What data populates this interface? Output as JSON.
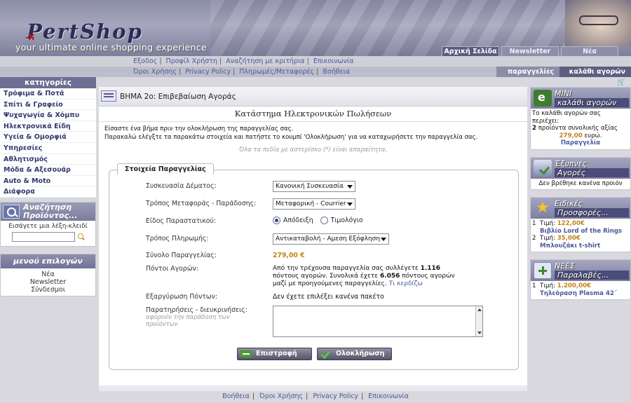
{
  "header": {
    "logo_text": "PertShop",
    "logo_mark": "x",
    "tagline": "your ultimate online shopping experience",
    "tabs": [
      "Αρχική Σελίδα",
      "Newsletter",
      "Νέα"
    ]
  },
  "topnav": {
    "row1": [
      "Εξοδος",
      "Προφίλ Χρήστη",
      "Αναζήτηση με κριτήρια",
      "Επικοινωνία"
    ],
    "row2": [
      "Όροι Χρήσης",
      "Privacy Policy",
      "Πληρωμές/Μεταφορές",
      "Βοήθεια"
    ],
    "orders_label": "παραγγελίες",
    "cart_label": "καλάθι αγορών"
  },
  "sidebar": {
    "categories_title": "κατηγορίες",
    "categories": [
      "Τρόφιμα & Ποτά",
      "Σπίτι & Γραφείο",
      "Ψυχαγωγία & Χόμπυ",
      "Ηλεκτρονικά Είδη",
      "Υγεία & Ομορφιά",
      "Υπηρεσίες",
      "Αθλητισμός",
      "Μόδα & Αξεσουάρ",
      "Auto & Moto",
      "Διάφορα"
    ],
    "search_title_line1": "Αναζήτηση",
    "search_title_line2": "Προϊόντος...",
    "search_hint": "Εισάγετε μια λέξη-κλειδί",
    "search_value": "",
    "menu_title": "μενού επιλογών",
    "menu_items": [
      "Νέα",
      "Newsletter",
      "Σύνδεσμοι"
    ]
  },
  "main": {
    "step_title": "ΒΗΜΑ 2ο: Επιβεβαίωση Αγοράς",
    "store_title": "Κατάστημα Ηλεκτρονικών Πωλήσεων",
    "intro_line1": "Είσαστε ένα βήμα πριν την ολοκλήρωση της παραγγελίας σας.",
    "intro_line2": "Παρακαλώ ελέγξτε τα παρακάτω στοιχεία και πατήστε το κουμπί 'Ολοκλήρωση' για να καταχωρήσετε την παραγγελία σας.",
    "required_note": "Όλα τα πεδία με αστερίσκο (*) είναι απαραίτητα.",
    "legend": "Στοιχεία Παραγγελίας",
    "fields": {
      "packaging_label": "Συσκευασία Δέματος:",
      "packaging_value": "Κανονική Συσκευασία",
      "shipping_label": "Τρόπος Μεταφοράς - Παράδοσης:",
      "shipping_value": "Μεταφορική - Courrier",
      "document_label": "Είδος Παραστατικού:",
      "document_opt1": "Απόδειξη",
      "document_opt2": "Τιμολόγιο",
      "payment_label": "Τρόπος Πληρωμής:",
      "payment_value": "Αντικαταβολή - Αμεση Εξόφληση",
      "total_label": "Σύνολο Παραγγελίας:",
      "total_value": "279,00 €",
      "points_label": "Πόντοι Αγορών:",
      "points_text_1": "Από την τρέχουσα παραγγελία σας συλλέγετε ",
      "points_value": "1.116",
      "points_text_2": " πόντους αγορών. Συνολικά έχετε ",
      "points_total": "6.056",
      "points_text_3": " πόντους αγορών μαζί με προηγούμενες παραγγελίες. ",
      "points_link": "Τι κερδίζω",
      "redeem_label": "Εξαργύρωση Πόντων:",
      "redeem_value": "Δεν έχετε επιλέξει κανένα πακέτο",
      "notes_label": "Παρατηρήσεις - διευκρινήσεις:",
      "notes_hint": "αφορούν την παράδοση των προϊόντων",
      "notes_value": ""
    },
    "back_button": "Επιστροφή",
    "complete_button": "Ολοκλήρωση"
  },
  "rightbar": {
    "mini_cart": {
      "title1": "ΜΙΝΙ",
      "title2": "καλάθι αγορών",
      "line1": "Το καλάθι αγορών σας περιέχει:",
      "count": "2",
      "line2": " προϊόντα συνολικής αξίας",
      "amount": "279,00",
      "currency_word": " ευρώ.",
      "link": "Παραγγελία"
    },
    "smart": {
      "title1": "Έξυπνες",
      "title2": "Αγορές",
      "text": "Δεν βρέθηκε κανένα προιόν"
    },
    "offers": {
      "title1": "Ειδικές",
      "title2": "Προσφορές...",
      "items": [
        {
          "num": "1",
          "price_label": "Τιμή: ",
          "price": "122,00€",
          "name": "Βιβλίο Lord of the Rings"
        },
        {
          "num": "2",
          "price_label": "Τιμή: ",
          "price": "35,00€",
          "name": "Μπλουζάκι t-shirt"
        }
      ]
    },
    "new_arrivals": {
      "title1": "ΝΕΕΣ",
      "title2": "Παραλαβές...",
      "items": [
        {
          "num": "1",
          "price_label": "Τιμή: ",
          "price": "1.200,00€",
          "name": "Τηλεόραση Plasma 42´"
        }
      ]
    }
  },
  "footer": {
    "links": [
      "Βοήθεια",
      "Όροι Χρήσης",
      "Privacy Policy",
      "Επικοινωνία"
    ]
  }
}
